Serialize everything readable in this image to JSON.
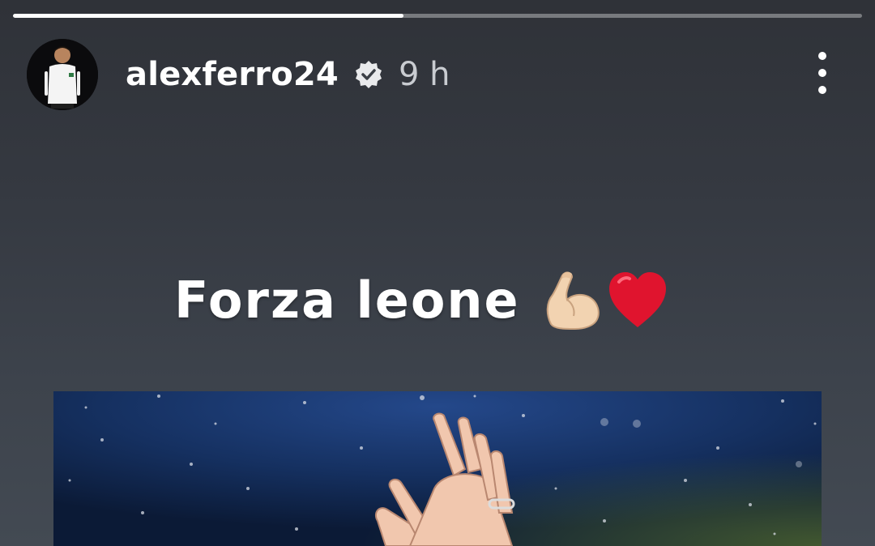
{
  "story": {
    "progress": 0.46,
    "username": "alexferro24",
    "verified": true,
    "time_ago": "9 h",
    "caption": "Forza leone",
    "caption_emojis": [
      "flexed-biceps",
      "red-heart"
    ]
  },
  "colors": {
    "background_top": "#2f3238",
    "background_bottom": "#434a53",
    "text": "#ffffff",
    "time_text": "#c9ccd1",
    "photo_sky": "#142c58",
    "heart": "#e0142e"
  },
  "icons": {
    "verified": "verified-badge-icon",
    "more": "more-options-icon"
  }
}
